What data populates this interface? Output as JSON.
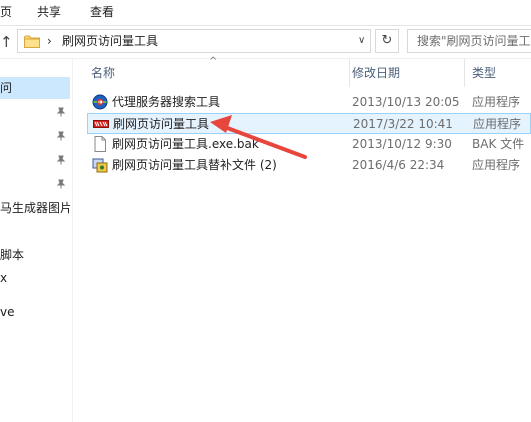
{
  "ribbon": {
    "tabs": [
      {
        "label": "页"
      },
      {
        "label": "共享"
      },
      {
        "label": "查看"
      }
    ]
  },
  "address": {
    "separator": "›",
    "breadcrumb": "刷网页访问量工具",
    "dropdown_glyph": "∨",
    "refresh_glyph": "↻",
    "up_glyph": "↑"
  },
  "search": {
    "placeholder": "搜索\"刷网页访问量工具\""
  },
  "nav": {
    "items": [
      {
        "label": "问",
        "selected": true,
        "pinned": false
      },
      {
        "label": "",
        "selected": false,
        "pinned": true
      },
      {
        "label": "",
        "selected": false,
        "pinned": true
      },
      {
        "label": "",
        "selected": false,
        "pinned": true
      },
      {
        "label": "",
        "selected": false,
        "pinned": true
      },
      {
        "label": "马生成器图片",
        "selected": false,
        "pinned": false
      },
      {
        "label": "脚本",
        "selected": false,
        "pinned": false
      },
      {
        "label": "x",
        "selected": false,
        "pinned": false
      },
      {
        "label": "ve",
        "selected": false,
        "pinned": false
      }
    ]
  },
  "columns": {
    "name": "名称",
    "date": "修改日期",
    "type": "类型",
    "sort_glyph": "^"
  },
  "files": [
    {
      "name": "代理服务器搜索工具",
      "date": "2013/10/13 20:05",
      "type": "应用程序",
      "icon": "globe-app-icon",
      "highlight": false
    },
    {
      "name": "刷网页访问量工具",
      "date": "2017/3/22 10:41",
      "type": "应用程序",
      "icon": "red-app-icon",
      "highlight": true
    },
    {
      "name": "刷网页访问量工具.exe.bak",
      "date": "2013/10/12 9:30",
      "type": "BAK 文件",
      "icon": "blank-file-icon",
      "highlight": false
    },
    {
      "name": "刷网页访问量工具替补文件 (2)",
      "date": "2016/4/6 22:34",
      "type": "应用程序",
      "icon": "installer-app-icon",
      "highlight": false
    }
  ],
  "colors": {
    "selection_bg": "#cce8ff",
    "hover_border": "#99d1ff",
    "header_text": "#4c607a",
    "annotation_arrow": "#e8453c"
  }
}
